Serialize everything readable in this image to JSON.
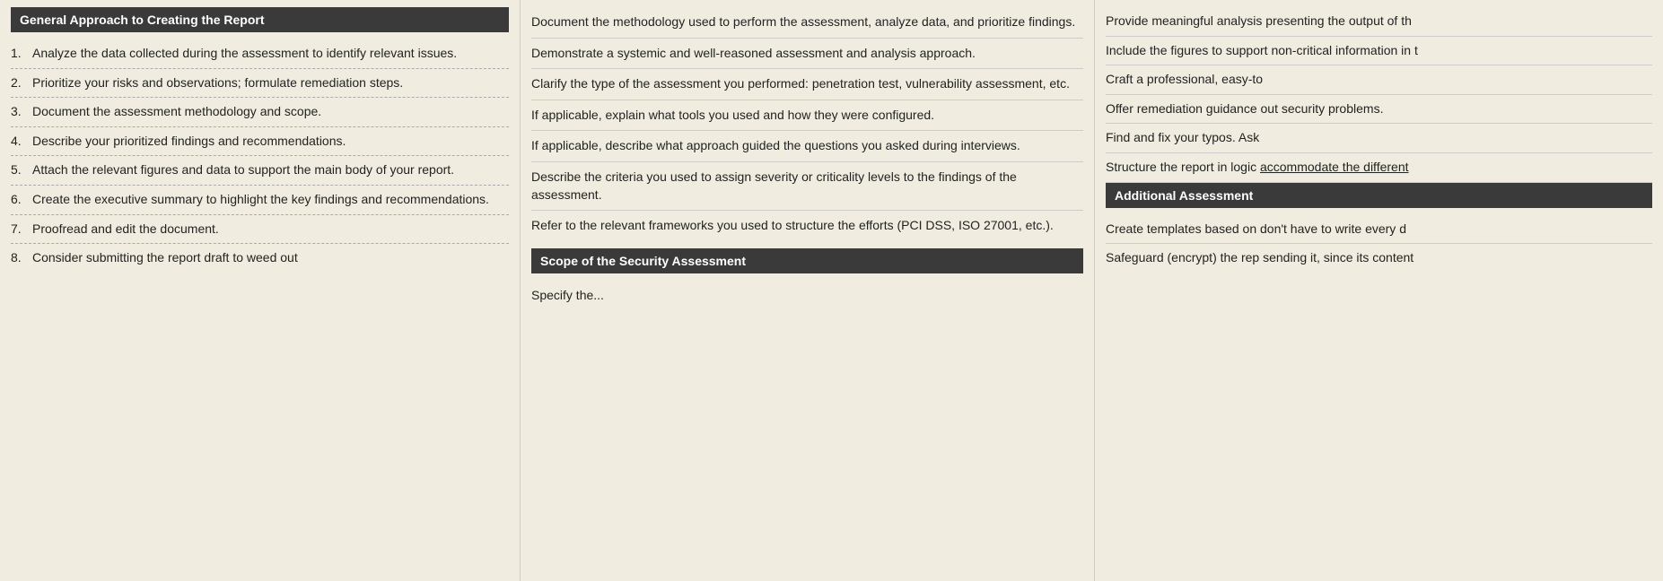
{
  "col1": {
    "header": "General Approach to Creating the Report",
    "items": [
      {
        "num": "1.",
        "text": "Analyze the data collected during the assessment to identify relevant issues."
      },
      {
        "num": "2.",
        "text": "Prioritize your risks and observations; formulate remediation steps."
      },
      {
        "num": "3.",
        "text": "Document the assessment methodology and scope."
      },
      {
        "num": "4.",
        "text": "Describe your prioritized findings and recommendations."
      },
      {
        "num": "5.",
        "text": "Attach the relevant figures and data to support the main body of your report."
      },
      {
        "num": "6.",
        "text": "Create the executive summary to highlight the key findings and recommendations."
      },
      {
        "num": "7.",
        "text": "Proofread and edit the document."
      },
      {
        "num": "8.",
        "text": "Consider submitting the report draft to weed out"
      }
    ]
  },
  "col2": {
    "paras": [
      "Document the methodology used to perform the assessment, analyze data, and prioritize findings.",
      "Demonstrate a systemic and well-reasoned assessment and analysis approach.",
      "Clarify the type of the assessment you performed: penetration test, vulnerability assessment, etc.",
      "If applicable, explain what tools you used and how they were configured.",
      "If applicable, describe what approach guided the questions you asked during interviews.",
      "Describe the criteria you used to assign severity or criticality levels to the findings of the assessment.",
      "Refer to the relevant frameworks you used to structure the efforts (PCI DSS, ISO 27001, etc.)."
    ],
    "section2_header": "Scope of the Security Assessment",
    "section2_preview": "Specify the..."
  },
  "col3": {
    "items": [
      {
        "text": "Provide meaningful analysis presenting the output of th"
      },
      {
        "text": "Include the figures to support non-critical information in t"
      },
      {
        "text": "Craft a professional, easy-to"
      },
      {
        "text": "Offer remediation guidance out security problems."
      },
      {
        "text": "Find and fix your typos. Ask"
      },
      {
        "text": "Structure the report in logic accommodate the different",
        "underline": "accommodate the different"
      },
      {
        "is_header": true,
        "text": "Additional Assessment"
      },
      {
        "text": "Create templates based on don't have to write every d"
      },
      {
        "text": "Safeguard (encrypt) the rep sending it, since its content"
      }
    ]
  }
}
